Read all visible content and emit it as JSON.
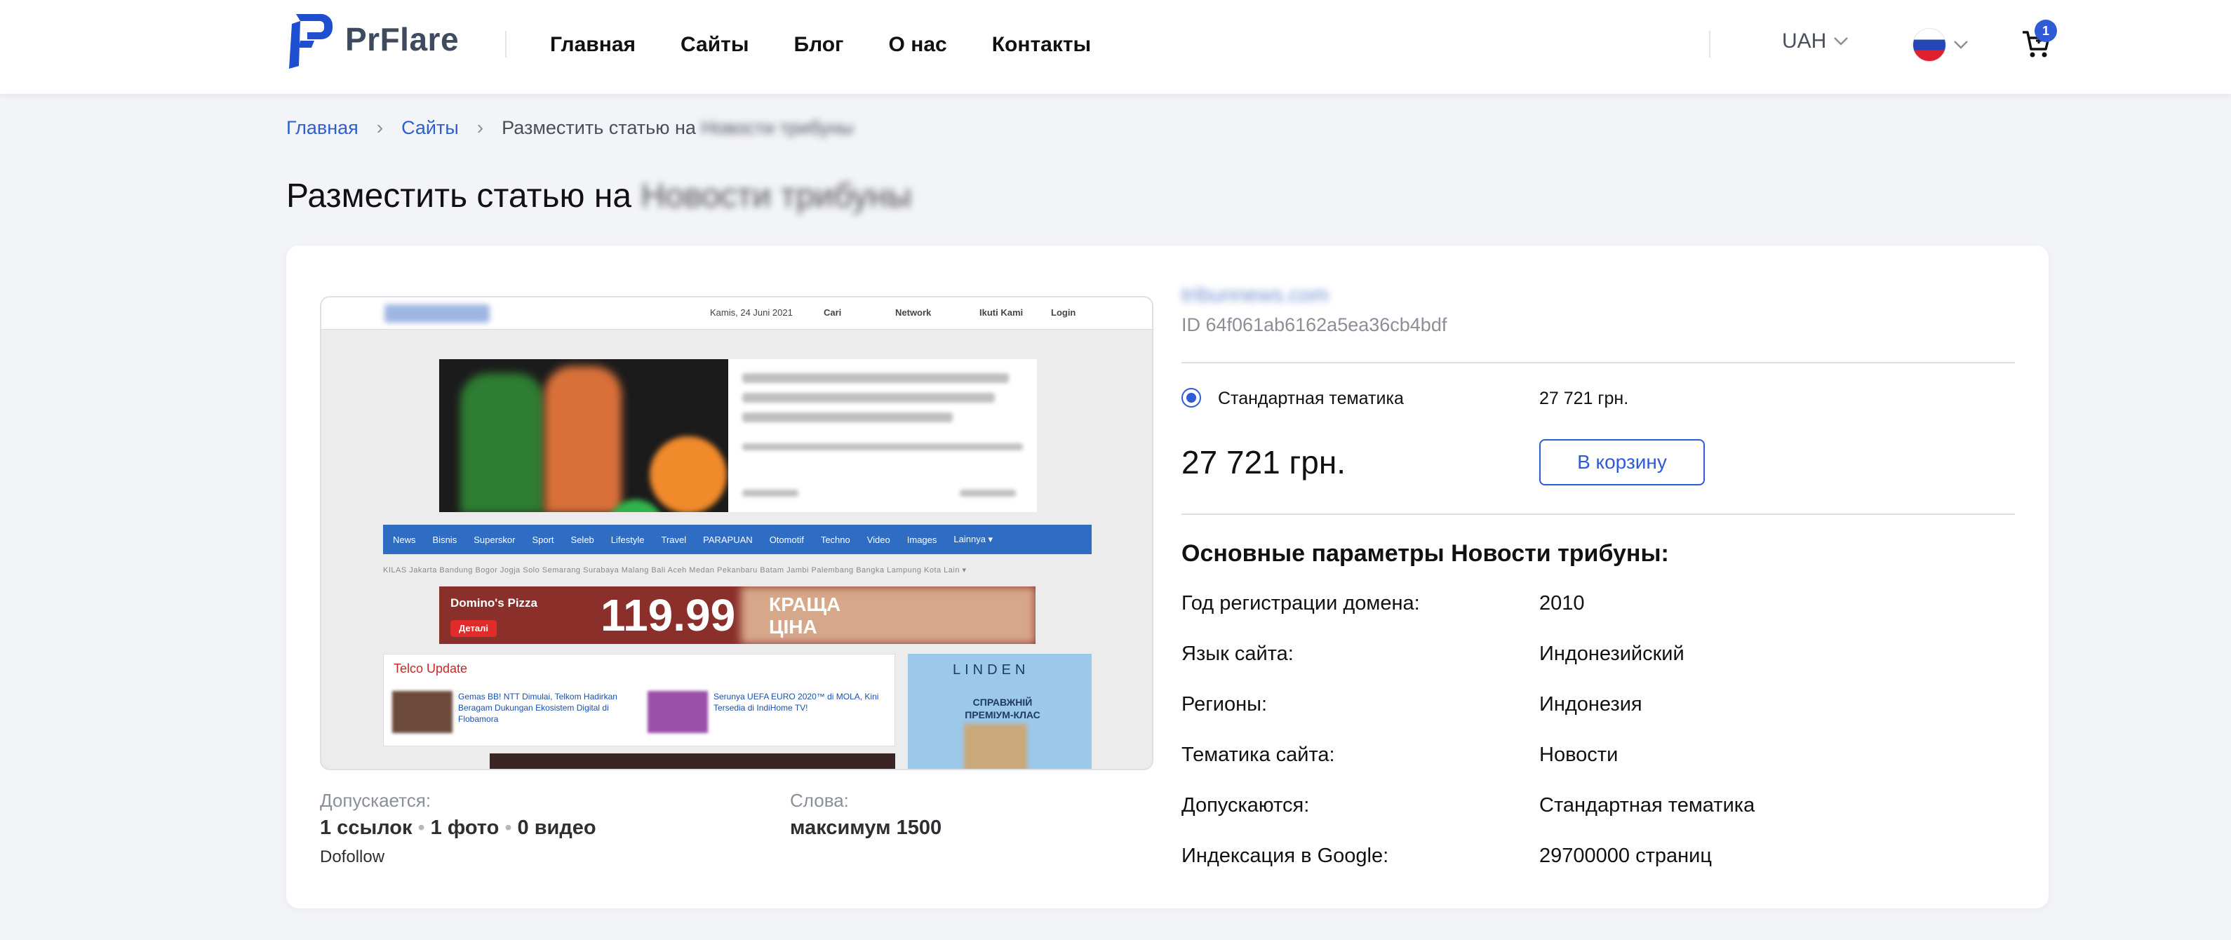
{
  "header": {
    "logo_text": "PrFlare",
    "nav": [
      "Главная",
      "Сайты",
      "Блог",
      "О нас",
      "Контакты"
    ],
    "currency": "UAH",
    "language_flag": "russia-flag-icon",
    "cart_count": "1"
  },
  "breadcrumb": {
    "home": "Главная",
    "sites": "Сайты",
    "current_prefix": "Разместить статью на",
    "current_site": "Новости трибуны"
  },
  "page": {
    "title_prefix": "Разместить статью на",
    "title_site": "Новости трибуны"
  },
  "preview": {
    "top_date": "Kamis, 24 Juni 2021",
    "top_links": [
      "Cari",
      "Network",
      "Ikuti Kami",
      "Login"
    ],
    "nav_items": [
      "News",
      "Bisnis",
      "Superskor",
      "Sport",
      "Seleb",
      "Lifestyle",
      "Travel",
      "PARAPUAN",
      "Otomotif",
      "Techno",
      "Video",
      "Images",
      "Lainnya ▾"
    ],
    "sub_nav": "KILAS  Jakarta  Bandung  Bogor  Jogja  Solo  Semarang  Surabaya  Malang  Bali  Aceh  Medan  Pekanbaru  Batam  Jambi  Palembang  Bangka  Lampung  Kota Lain ▾",
    "ad_brand": "Domino's Pizza",
    "ad_details": "Деталі",
    "ad_price": "119.99",
    "ad_slogan": "КРАЩА ЦІНА",
    "telco_title": "Telco Update",
    "telco_item1": "Gemas BB! NTT Dimulai, Telkom Hadirkan Beragam Dukungan Ekosistem Digital di Flobamora",
    "telco_item2": "Serunya UEFA EURO 2020™ di MOLA, Kini Tersedia di IndiHome TV!",
    "linden_title": "LINDEN",
    "linden_slogan": "СПРАВЖНІЙ ПРЕМІУМ-КЛАС"
  },
  "placement": {
    "allowed_label": "Допускается:",
    "links": "1 ссылок",
    "photos": "1 фото",
    "videos": "0 видео",
    "dofollow": "Dofollow",
    "words_label": "Слова:",
    "words_value": "максимум 1500"
  },
  "site": {
    "domain": "tribunnews.com",
    "id": "ID 64f061ab6162a5ea36cb4bdf",
    "option_label": "Стандартная тематика",
    "option_price": "27 721 грн.",
    "total_price": "27 721 грн.",
    "cart_button": "В корзину",
    "params_title": "Основные параметры Новости трибуны:",
    "params": [
      {
        "k": "Год регистрации домена:",
        "v": "2010"
      },
      {
        "k": "Язык сайта:",
        "v": "Индонезийский"
      },
      {
        "k": "Регионы:",
        "v": "Индонезия"
      },
      {
        "k": "Тематика сайта:",
        "v": "Новости"
      },
      {
        "k": "Допускаются:",
        "v": "Стандартная тематика"
      },
      {
        "k": "Индексация в Google:",
        "v": "29700000 страниц"
      }
    ]
  },
  "colors": {
    "accent": "#2f5bd6",
    "link": "#2d5fcf",
    "background": "#f3f4f8",
    "logo": "#1f4fd1"
  }
}
